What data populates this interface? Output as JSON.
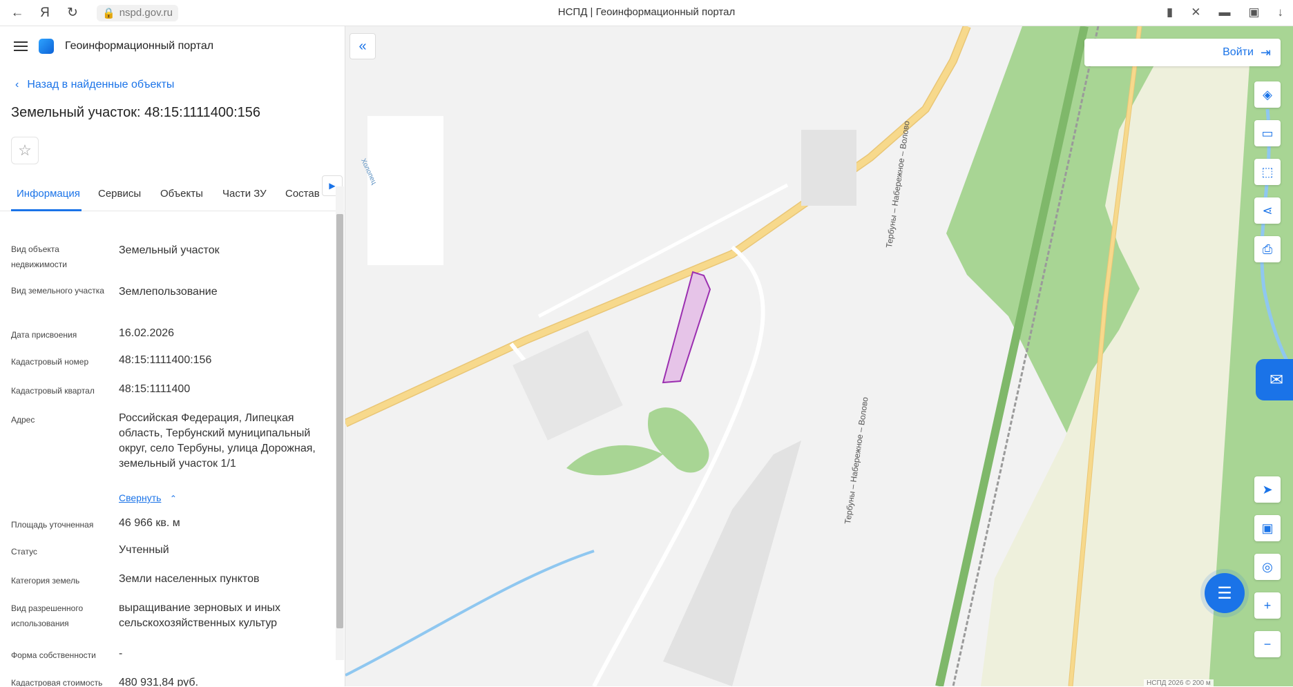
{
  "browser": {
    "url": "nspd.gov.ru",
    "title": "НСПД | Геоинформационный портал",
    "icons": [
      "back-icon",
      "yandex-icon",
      "reload-icon",
      "lock-icon",
      "bookmark-icon",
      "extension-icon",
      "wallet-icon",
      "collections-icon",
      "download-icon"
    ]
  },
  "panel": {
    "brand": "Геоинформационный портал",
    "back_link": "Назад в найденные объекты",
    "object_title": "Земельный участок: 48:15:1111400:156",
    "tabs": [
      {
        "label": "Информация",
        "active": true
      },
      {
        "label": "Сервисы"
      },
      {
        "label": "Объекты"
      },
      {
        "label": "Части ЗУ"
      },
      {
        "label": "Состав"
      }
    ],
    "collapse_label": "Свернуть",
    "fields": [
      {
        "label": "Вид объекта недвижимости",
        "value": "Земельный участок"
      },
      {
        "label": "Вид земельного участка",
        "value": "Землепользование"
      },
      {
        "label": "Дата присвоения",
        "value": "16.02.2026"
      },
      {
        "label": "Кадастровый номер",
        "value": "48:15:1111400:156"
      },
      {
        "label": "Кадастровый квартал",
        "value": "48:15:1111400"
      },
      {
        "label": "Адрес",
        "value": "Российская Федерация, Липецкая область, Тербунский муниципальный округ, село Тербуны, улица Дорожная, земельный участок 1/1"
      },
      {
        "label": "Площадь уточненная",
        "value": "46 966 кв. м"
      },
      {
        "label": "Статус",
        "value": "Учтенный"
      },
      {
        "label": "Категория земель",
        "value": "Земли населенных пунктов"
      },
      {
        "label": "Вид разрешенного использования",
        "value": "выращивание зерновых и иных сельскохозяйственных культур"
      },
      {
        "label": "Форма собственности",
        "value": "-"
      },
      {
        "label": "Кадастровая стоимость",
        "value": "480 931,84 руб."
      }
    ]
  },
  "map": {
    "login_label": "Войти",
    "road_labels": [
      "Тербуны – Набережное – Волово",
      "Тербуны – Набережное – Волово"
    ],
    "river_label": "Холопец",
    "attribution": "НСПД 2026 ©   200 м",
    "tools": [
      "layers-icon",
      "ruler-icon",
      "select-area-icon",
      "share-icon",
      "print-icon",
      "locate-icon",
      "minimap-icon",
      "geolocation-icon",
      "zoom-in-icon",
      "zoom-out-icon"
    ],
    "colors": {
      "green": "#a8d594",
      "road": "#f7d98c",
      "parcel_fill": "#e6c4e8",
      "parcel_stroke": "#9b2fb0",
      "water": "#8fc7f0",
      "accent": "#1a73e8"
    }
  }
}
